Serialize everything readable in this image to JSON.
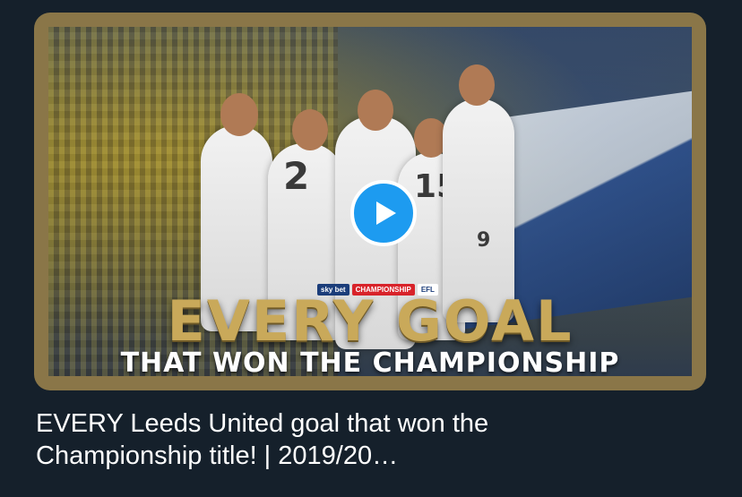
{
  "media": {
    "badge": {
      "sky": "sky bet",
      "league": "CHAMPIONSHIP",
      "efl": "EFL"
    },
    "headline": "EVERY GOAL",
    "subline": "THAT WON THE CHAMPIONSHIP",
    "players": [
      {
        "number": "2"
      },
      {
        "number": "15"
      },
      {
        "number": "9"
      }
    ],
    "colors": {
      "frame": "#8a7648",
      "accent": "#1d9bf0",
      "headline": "#c9a95a",
      "background": "#15202b"
    }
  },
  "caption": {
    "line1": "EVERY Leeds United goal that won the",
    "line2": "Championship title! | 2019/20…"
  }
}
